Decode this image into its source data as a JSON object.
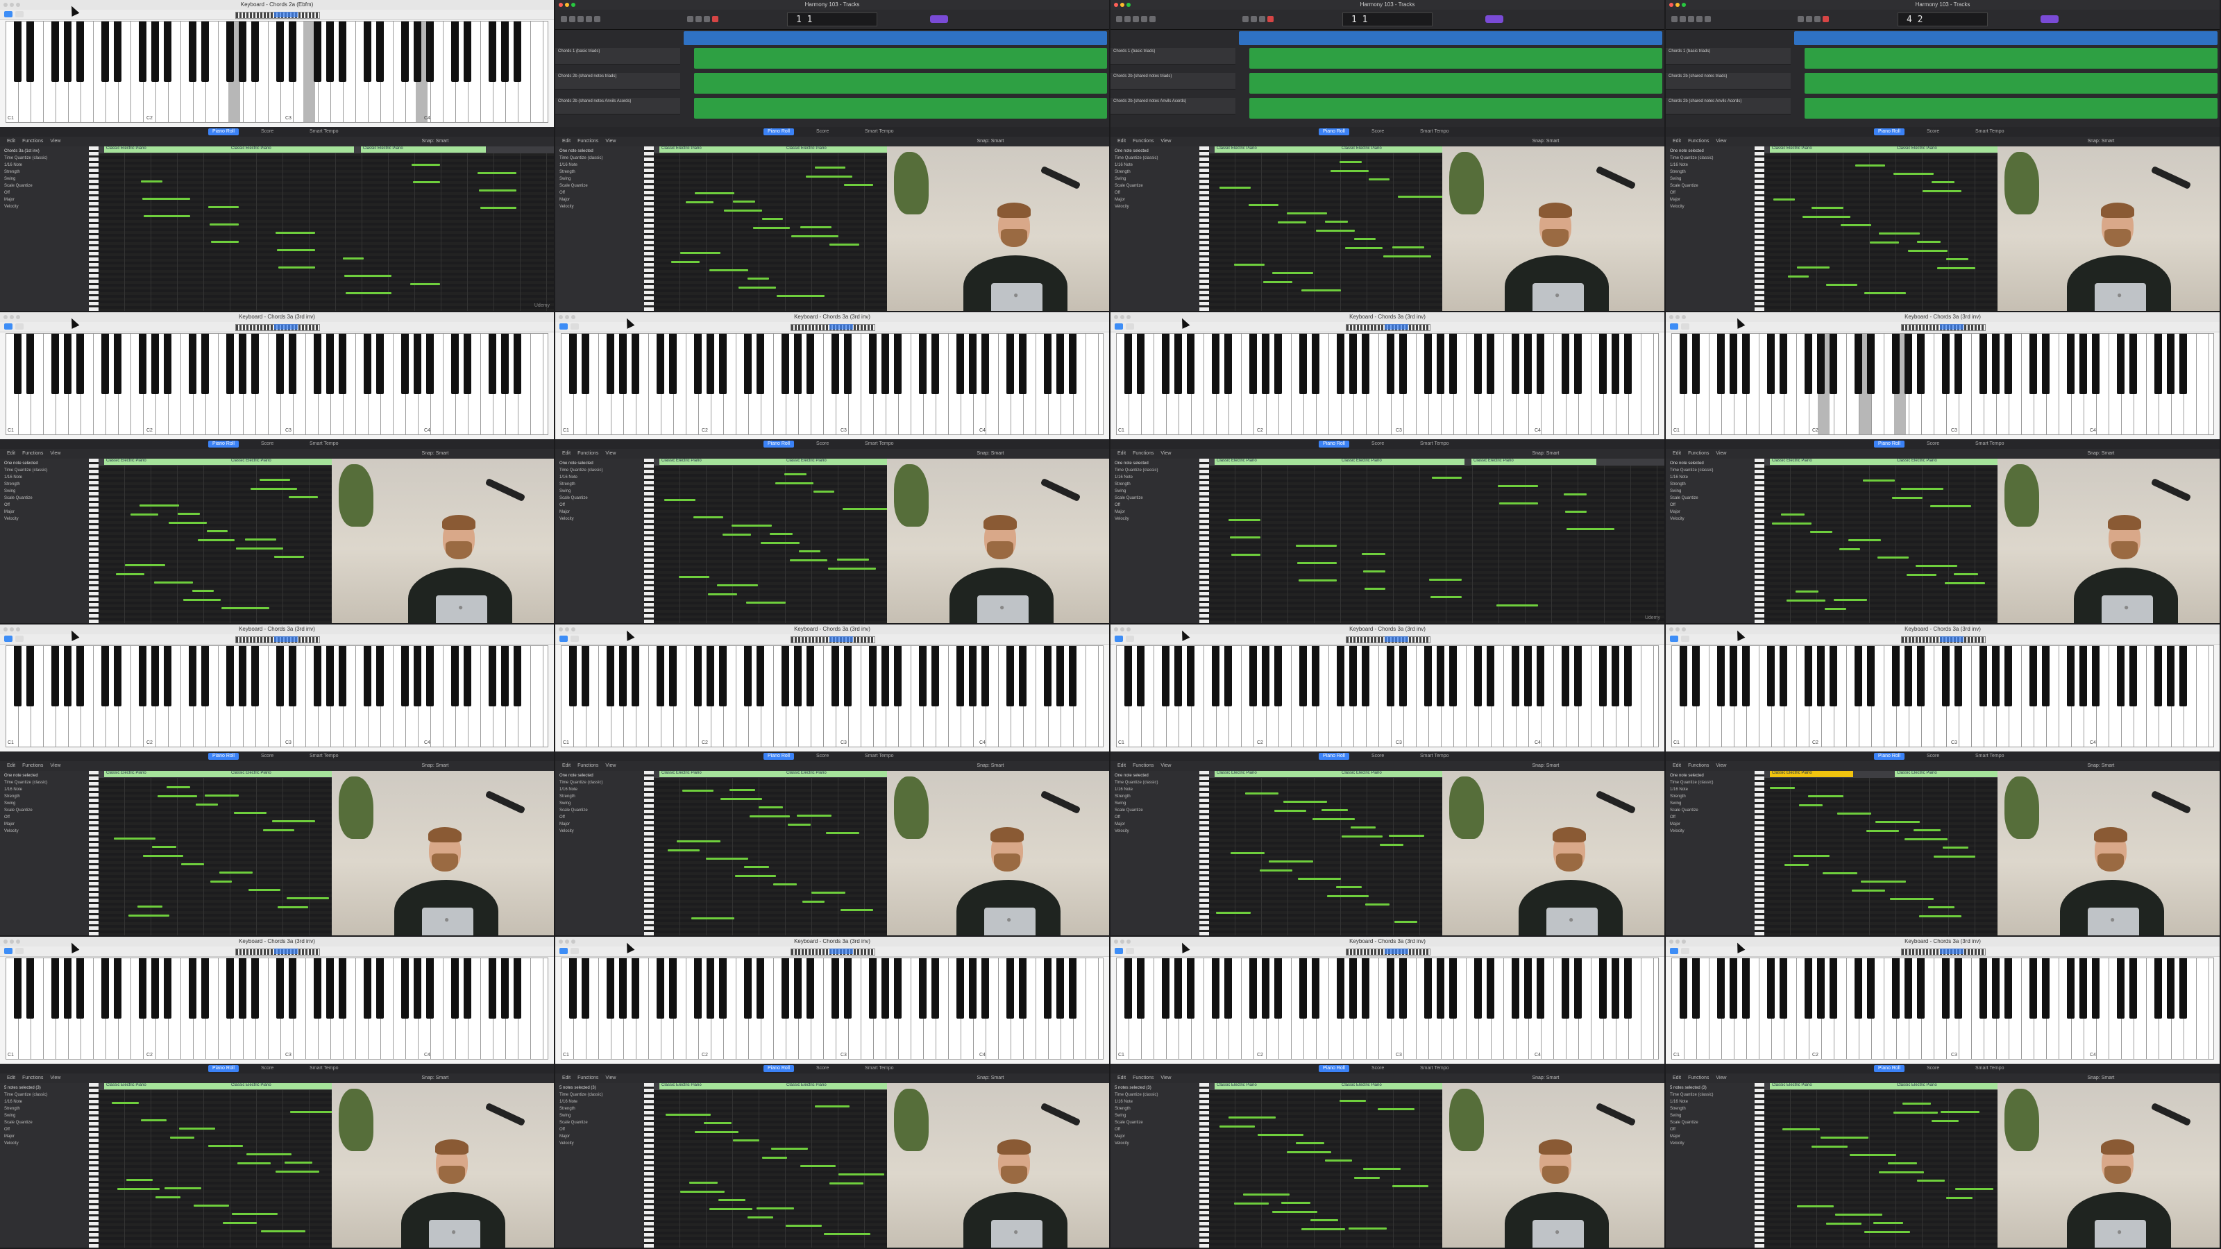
{
  "keyboard": {
    "title_top": "Keyboard - Chords 2a (Ebfm)",
    "title": "Keyboard - Chords 3a (3rd inv)",
    "c_labels": [
      "C1",
      "C2",
      "C3",
      "C4"
    ]
  },
  "project": {
    "title": "Harmony 103 - Tracks",
    "lcd": [
      "1 1",
      "1 1",
      "4 2"
    ],
    "tracks": [
      "Chords 1 (basic triads)",
      "Chords 2b (shared notes triads)",
      "Chords 2b (shared notes Anvils Acords)"
    ],
    "region": "Classic Electric Piano"
  },
  "piano_roll": {
    "tabs": [
      "Piano Roll",
      "Score",
      "Smart Tempo"
    ],
    "menu": [
      "Edit",
      "Functions",
      "View"
    ],
    "snap": "Snap: Smart",
    "inspector": [
      "Chords 3a (1st inv)",
      "Time Quantize (classic)",
      "1/16 Note",
      "Strength",
      "Swing",
      "Scale Quantize",
      "Off",
      "Major",
      "Velocity"
    ],
    "one_note_selected": "One note selected",
    "five_notes": "5 notes selected (3)",
    "region_label": "Classic Electric Piano"
  },
  "watermark": "Udemy"
}
